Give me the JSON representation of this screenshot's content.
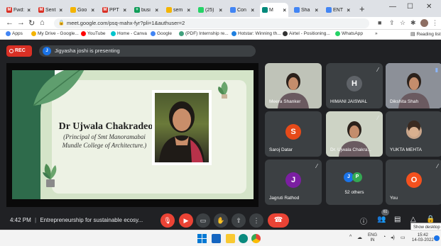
{
  "browser": {
    "tabs": [
      {
        "label": "Fwd:",
        "icon": "gmail-icon",
        "color": "#d93025",
        "glyph": "M"
      },
      {
        "label": "Sent",
        "icon": "gmail-icon",
        "color": "#d93025",
        "glyph": "M"
      },
      {
        "label": "Goo",
        "icon": "slides-icon",
        "color": "#f4b400",
        "glyph": ""
      },
      {
        "label": "PPT",
        "icon": "gmail-icon",
        "color": "#d93025",
        "glyph": "M"
      },
      {
        "label": "busi",
        "icon": "sheets-icon",
        "color": "#0f9d58",
        "glyph": "+"
      },
      {
        "label": "sem",
        "icon": "slides-icon",
        "color": "#f4b400",
        "glyph": ""
      },
      {
        "label": "(25)",
        "icon": "whatsapp-icon",
        "color": "#25d366",
        "glyph": ""
      },
      {
        "label": "Con",
        "icon": "docs-icon",
        "color": "#4285f4",
        "glyph": ""
      },
      {
        "label": "M",
        "icon": "meet-icon",
        "color": "#00897b",
        "glyph": ""
      },
      {
        "label": "Sha",
        "icon": "chrome-icon",
        "color": "#4285f4",
        "glyph": ""
      },
      {
        "label": "ENT",
        "icon": "chrome-icon",
        "color": "#4285f4",
        "glyph": ""
      }
    ],
    "url": "meet.google.com/psq-mahx-fyr?pli=1&authuser=2",
    "bookmarks": [
      {
        "label": "Apps",
        "color": "#4285f4"
      },
      {
        "label": "My Drive - Google...",
        "color": "#f4b400"
      },
      {
        "label": "YouTube",
        "color": "#ff0000"
      },
      {
        "label": "Home - Canva",
        "color": "#00c4cc"
      },
      {
        "label": "Google",
        "color": "#4285f4"
      },
      {
        "label": "(PDF) Internship re...",
        "color": "#41a07d"
      },
      {
        "label": "Hotstar: Winning th...",
        "color": "#1f80e0"
      },
      {
        "label": "Airtel - Positioning...",
        "color": "#333333"
      },
      {
        "label": "WhatsApp",
        "color": "#25d366"
      }
    ],
    "reading_list": "Reading list"
  },
  "meet": {
    "rec_label": "REC",
    "presenter_initial": "J",
    "presenting_text": "Jigyasha joshi is presenting",
    "slide": {
      "name": "Dr Ujwala Chakradeo",
      "subtitle_lines": [
        "(Principal of Smt Manoramabai",
        "Mundle College of Architecture.)"
      ]
    },
    "participants": [
      {
        "name": "Meera Shanker",
        "type": "video",
        "muted": false
      },
      {
        "name": "HIMANI JAISWAL",
        "type": "avatar",
        "initial": "H",
        "color": "#5f6368",
        "muted": true
      },
      {
        "name": "Dikshita Shah",
        "type": "video",
        "muted": false,
        "speaking": true
      },
      {
        "name": "Saroj Datar",
        "type": "avatar",
        "initial": "S",
        "color": "#e64a19",
        "muted": false
      },
      {
        "name": "Dr. Ujwala Chakra...",
        "type": "video",
        "muted": true
      },
      {
        "name": "YUKTA MEHTA",
        "type": "photo",
        "muted": false
      },
      {
        "name": "Jagruti Rathod",
        "type": "avatar",
        "initial": "J",
        "color": "#7b1fa2",
        "muted": true
      },
      {
        "name": "52 others",
        "type": "others",
        "initials": [
          "J",
          "P"
        ]
      },
      {
        "name": "You",
        "type": "avatar",
        "initial": "O",
        "color": "#f4511e",
        "muted": true
      }
    ],
    "time": "4:42 PM",
    "meeting_name": "Entrepreneurship for sustainable ecosy...",
    "people_count": "61",
    "tooltip": "Show desktop"
  },
  "taskbar": {
    "lang": "ENG",
    "region": "IN",
    "clock_time": "15:42",
    "clock_date": "14-03-2022"
  },
  "colors": {
    "meet_bg": "#202124",
    "tile_bg": "#3c4043",
    "red": "#ea4335",
    "accent_blue": "#1a73e8"
  }
}
